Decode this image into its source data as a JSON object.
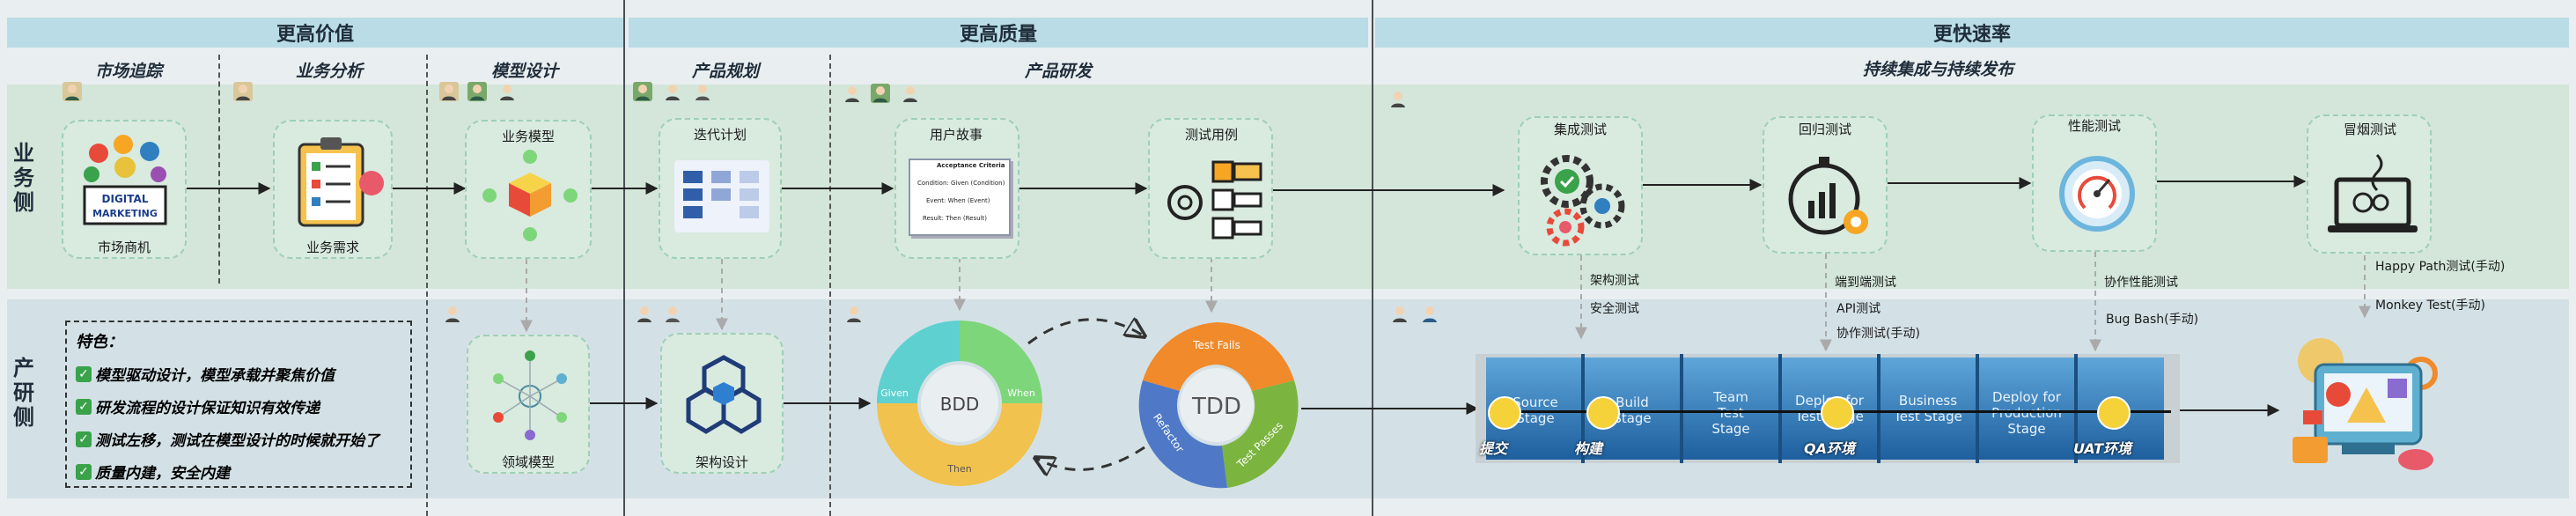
{
  "headers": [
    {
      "id": "value",
      "label": "更高价值"
    },
    {
      "id": "quality",
      "label": "更高质量"
    },
    {
      "id": "speed",
      "label": "更快速率"
    }
  ],
  "phases": [
    {
      "id": "market",
      "label": "市场追踪"
    },
    {
      "id": "analysis",
      "label": "业务分析"
    },
    {
      "id": "model",
      "label": "模型设计"
    },
    {
      "id": "plan",
      "label": "产品规划"
    },
    {
      "id": "rd",
      "label": "产品研发"
    },
    {
      "id": "ci",
      "label": "持续集成与持续发布"
    }
  ],
  "side_labels": {
    "business": "业\n务\n侧",
    "product": "产\n研\n侧"
  },
  "nodes": {
    "market_opportunity": "市场商机",
    "business_requirements": "业务需求",
    "business_model": "业务模型",
    "iteration_plan": "迭代计划",
    "user_story": "用户故事",
    "test_case": "测试用例",
    "integration_test": "集成测试",
    "regression_test": "回归测试",
    "performance_test": "性能测试",
    "smoke_test": "冒烟测试",
    "domain_model": "领域模型",
    "architecture_design": "架构设计"
  },
  "digital_marketing_logo": [
    "DIGITAL",
    "MARKETING"
  ],
  "user_story_card": [
    "Acceptance Criteria",
    "Condition: Given (Condition)",
    "Event: When (Event)",
    "Result: Then (Result)"
  ],
  "features": {
    "title": "特色：",
    "items": [
      "模型驱动设计，模型承载并聚焦价值",
      "研发流程的设计保证知识有效传递",
      "测试左移，测试在模型设计的时候就开始了",
      "质量内建，安全内建"
    ]
  },
  "bdd": {
    "center": "BDD",
    "given": "Given",
    "when": "When",
    "then": "Then"
  },
  "tdd": {
    "center": "TDD",
    "fails": "Test Fails",
    "passes": "Test Passes",
    "refactor": "Refactor"
  },
  "annotations": {
    "arch_test": "架构测试",
    "security_test": "安全测试",
    "e2e_test": "端到端测试",
    "api_test": "API测试",
    "protocol_test": "协作测试(手动)",
    "collab_perf_test": "协作性能测试",
    "bug_bash": "Bug Bash(手动)",
    "happy_path": "Happy Path测试(手动)",
    "monkey_test": "Monkey Test(手动)"
  },
  "pipeline": {
    "stages": [
      "Source\nStage",
      "Build\nStage",
      "Team\nTest\nStage",
      "Deploy for\nTest Stage",
      "Business\nTest Stage",
      "Deploy for\nProduction\nStage"
    ],
    "markers": [
      "提交",
      "构建",
      "QA环境",
      "UAT环境"
    ]
  },
  "colors": {
    "header_bg": "#b9dce6",
    "band_business": "#d3e6d9",
    "band_product": "#d3e1e6",
    "bdd_given": "#5fd0d0",
    "bdd_when": "#7ed67a",
    "bdd_then": "#f2c24e",
    "tdd_fail": "#f08a2a",
    "tdd_pass": "#7bb53f",
    "tdd_refactor": "#4f79c7",
    "pipeline": "#2f7fc1",
    "marker": "#f6d23a"
  }
}
